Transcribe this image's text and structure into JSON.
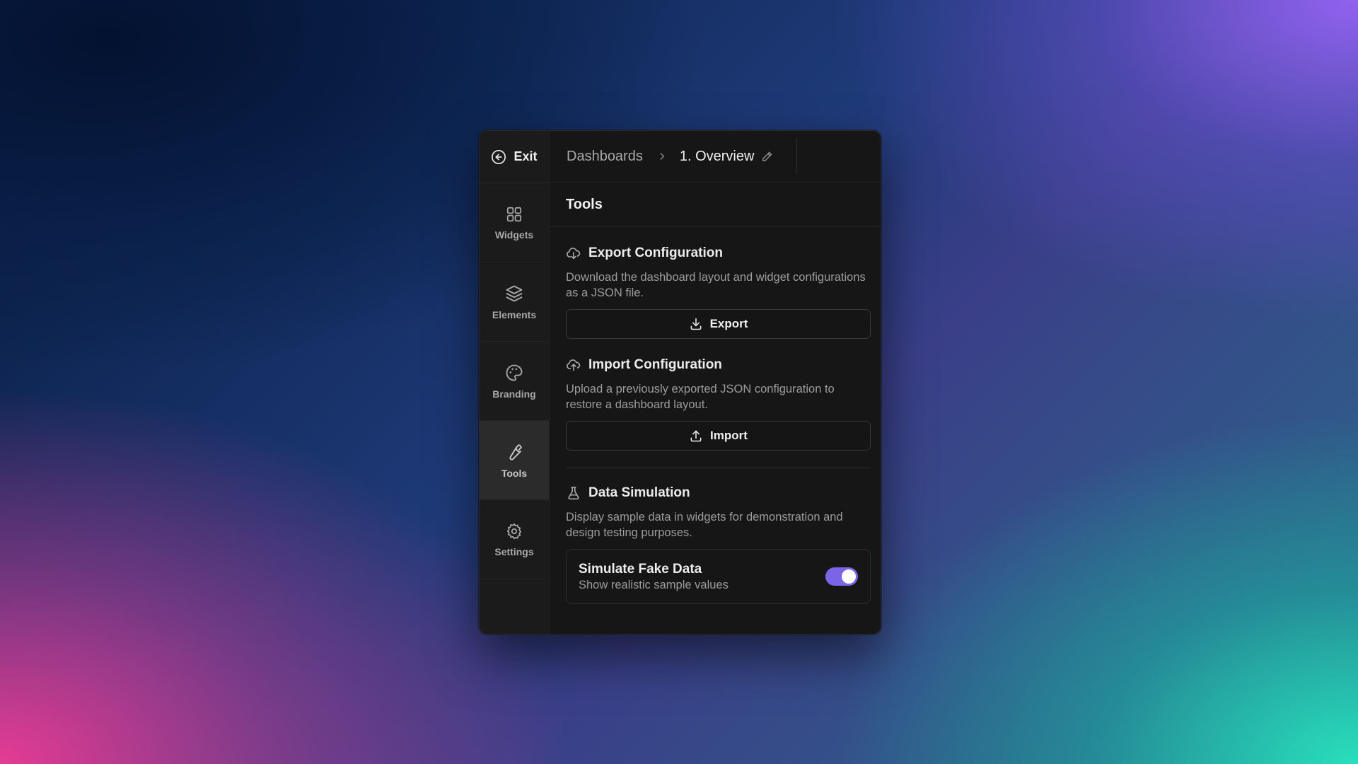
{
  "sidebar": {
    "exit_label": "Exit",
    "items": [
      {
        "label": "Widgets",
        "icon": "grid-icon",
        "active": false
      },
      {
        "label": "Elements",
        "icon": "layers-icon",
        "active": false
      },
      {
        "label": "Branding",
        "icon": "palette-icon",
        "active": false
      },
      {
        "label": "Tools",
        "icon": "wrench-icon",
        "active": true
      },
      {
        "label": "Settings",
        "icon": "gear-icon",
        "active": false
      }
    ]
  },
  "header": {
    "breadcrumb_root": "Dashboards",
    "breadcrumb_current": "1. Overview"
  },
  "main": {
    "title": "Tools",
    "export": {
      "title": "Export Configuration",
      "description": "Download the dashboard layout and widget configurations as a JSON file.",
      "button_label": "Export"
    },
    "import": {
      "title": "Import Configuration",
      "description": "Upload a previously exported JSON configuration to restore a dashboard layout.",
      "button_label": "Import"
    },
    "simulation": {
      "title": "Data Simulation",
      "description": "Display sample data in widgets for demonstration and design testing purposes.",
      "toggle_title": "Simulate Fake Data",
      "toggle_subtitle": "Show realistic sample values",
      "toggle_on": true
    }
  },
  "colors": {
    "accent": "#7c64e6",
    "panel": "#161616",
    "rail": "#1b1b1b"
  }
}
